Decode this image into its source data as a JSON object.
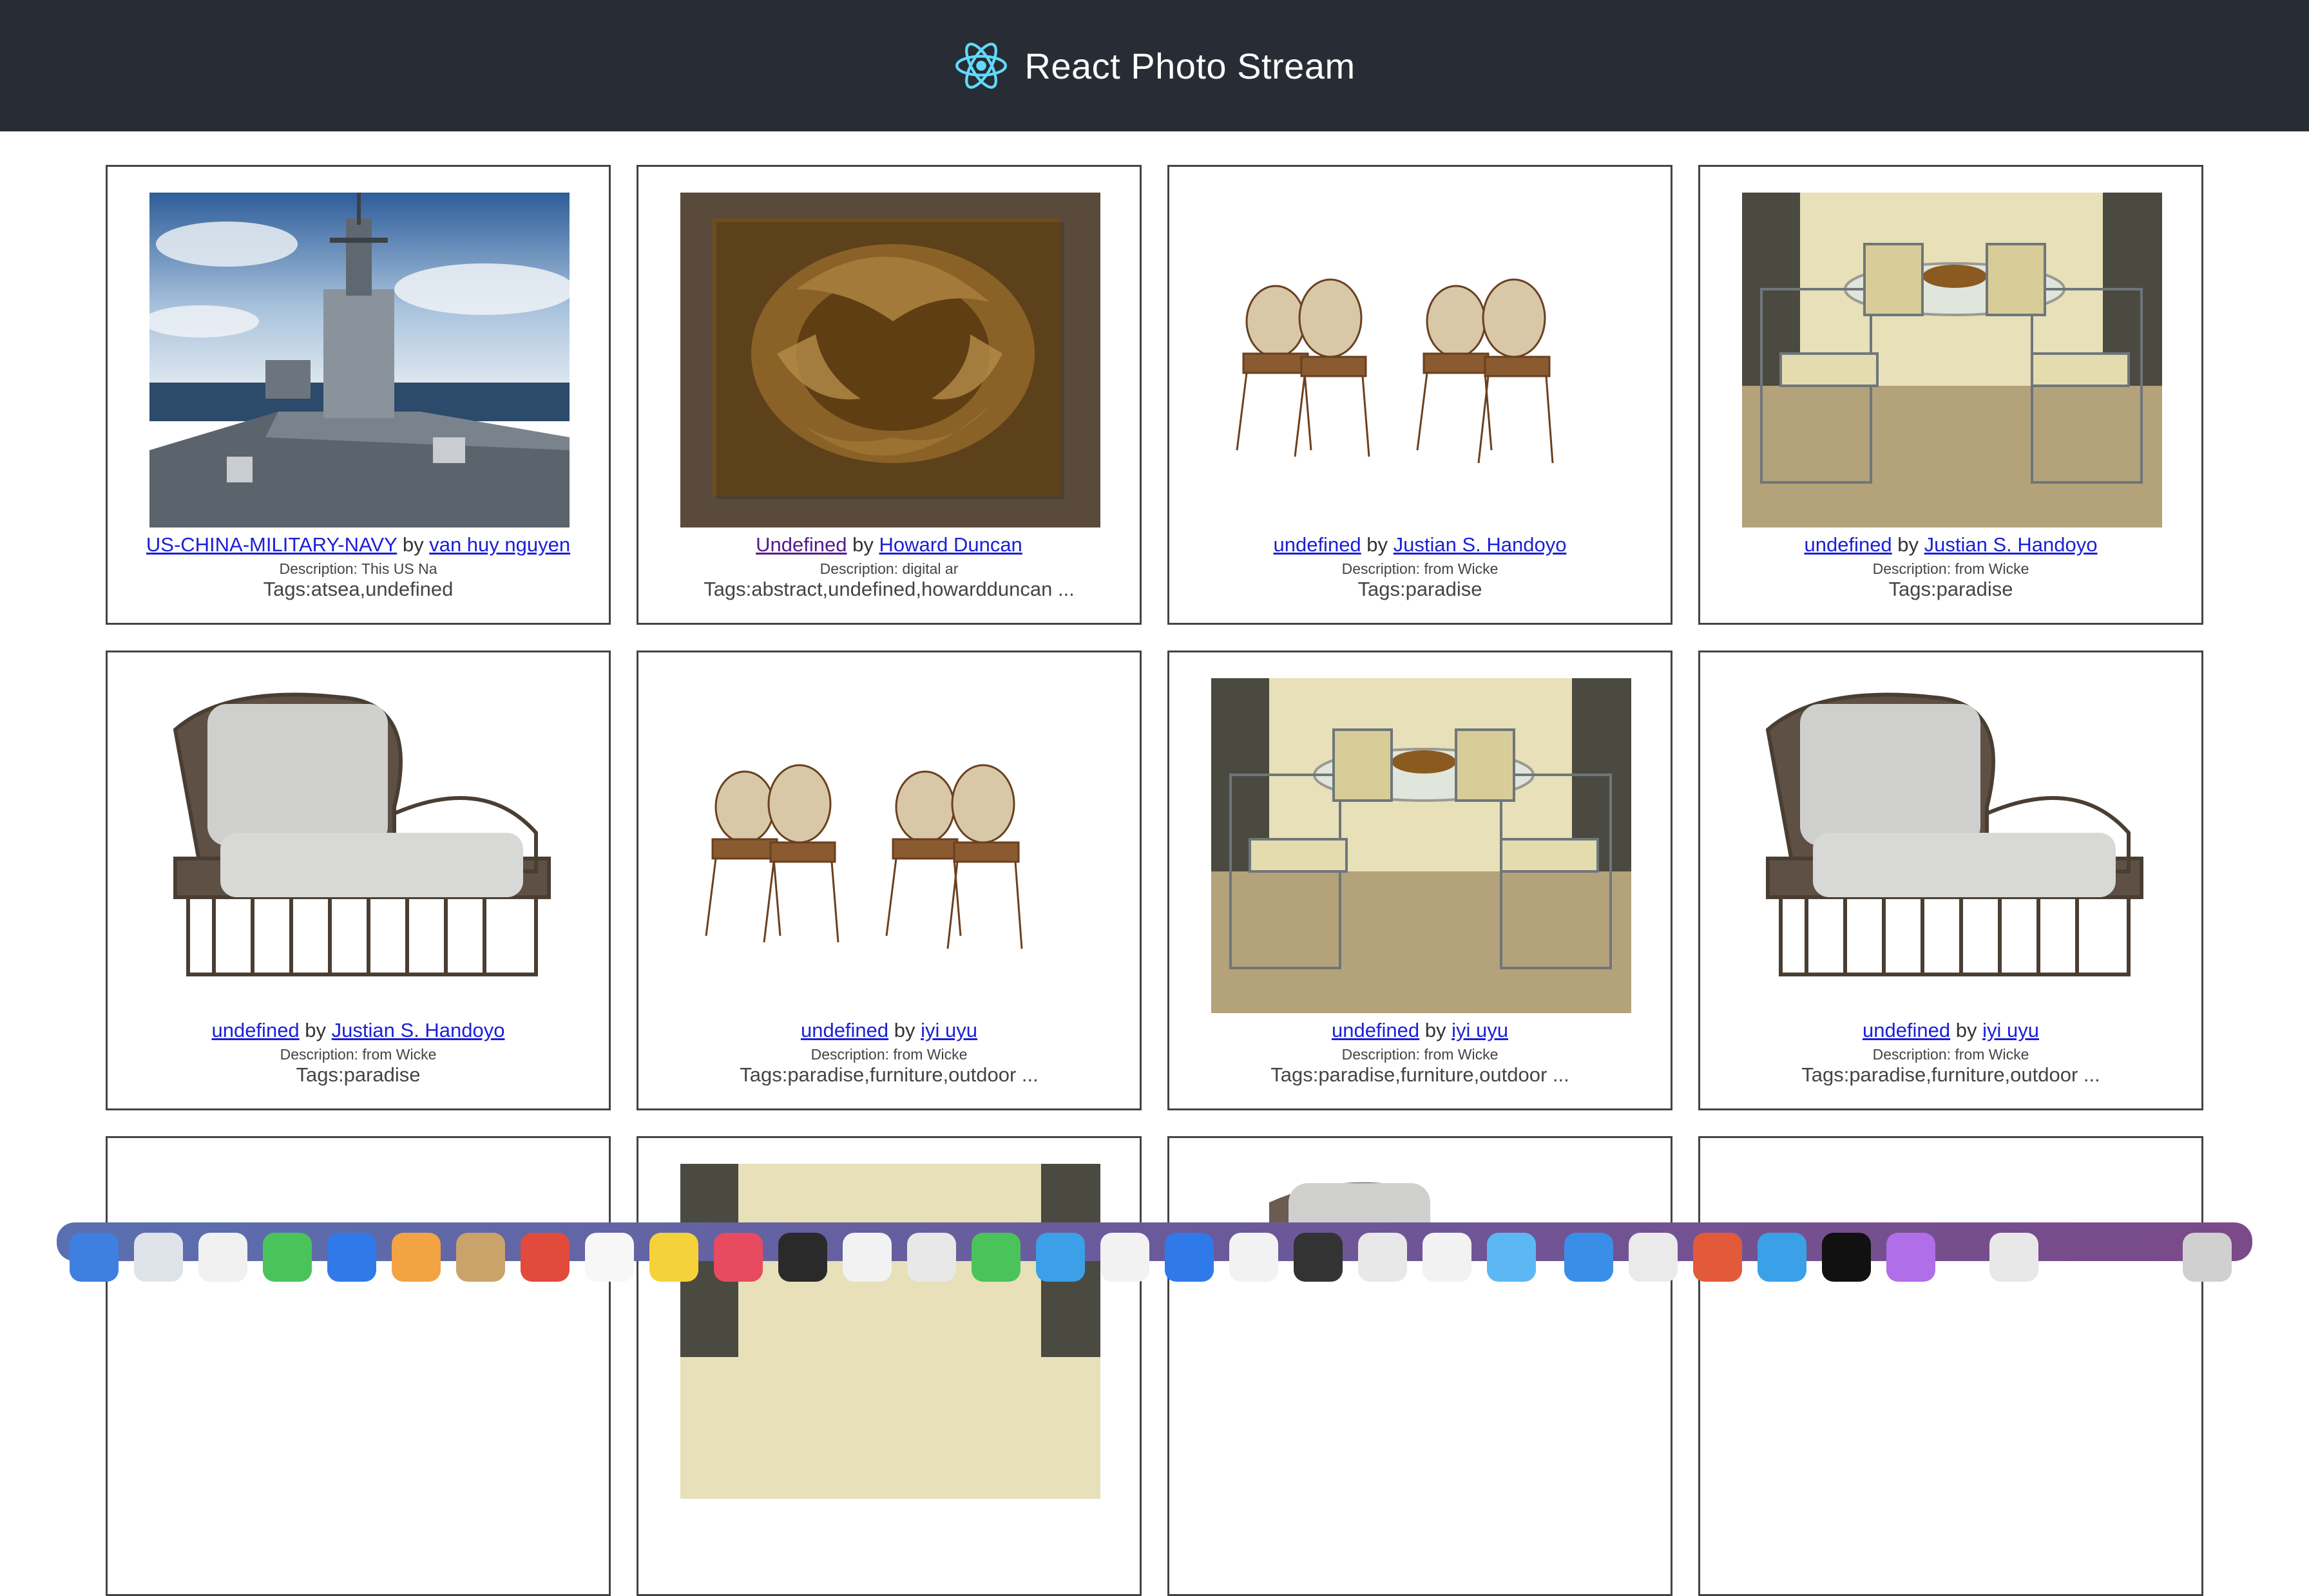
{
  "header": {
    "title": "React Photo Stream"
  },
  "by_word": "by",
  "photos": [
    {
      "title": "US-CHINA-MILITARY-NAVY",
      "author": "van huy nguyen",
      "description": "Description: This US Na",
      "tags": "Tags:atsea,undefined",
      "image": "warship"
    },
    {
      "title": "Undefined",
      "author": "Howard Duncan",
      "description": "Description: digital ar",
      "tags": "Tags:abstract,undefined,howardduncan ...",
      "image": "abstract-art"
    },
    {
      "title": "undefined",
      "author": "Justian S. Handoyo",
      "description": "Description: from Wicke",
      "tags": "Tags:paradise",
      "image": "bistro-chairs"
    },
    {
      "title": "undefined",
      "author": "Justian S. Handoyo",
      "description": "Description: from Wicke",
      "tags": "Tags:paradise",
      "image": "dining-set"
    },
    {
      "title": "undefined",
      "author": "Justian S. Handoyo",
      "description": "Description: from Wicke",
      "tags": "Tags:paradise",
      "image": "wicker-armchair"
    },
    {
      "title": "undefined",
      "author": "iyi uyu",
      "description": "Description: from Wicke",
      "tags": "Tags:paradise,furniture,outdoor ...",
      "image": "bistro-chairs"
    },
    {
      "title": "undefined",
      "author": "iyi uyu",
      "description": "Description: from Wicke",
      "tags": "Tags:paradise,furniture,outdoor ...",
      "image": "dining-set"
    },
    {
      "title": "undefined",
      "author": "iyi uyu",
      "description": "Description: from Wicke",
      "tags": "Tags:paradise,furniture,outdoor ...",
      "image": "wicker-armchair"
    }
  ],
  "colors": {
    "header_bg": "#282c34",
    "link": "#1a1fd8",
    "react_logo": "#61dafb"
  }
}
